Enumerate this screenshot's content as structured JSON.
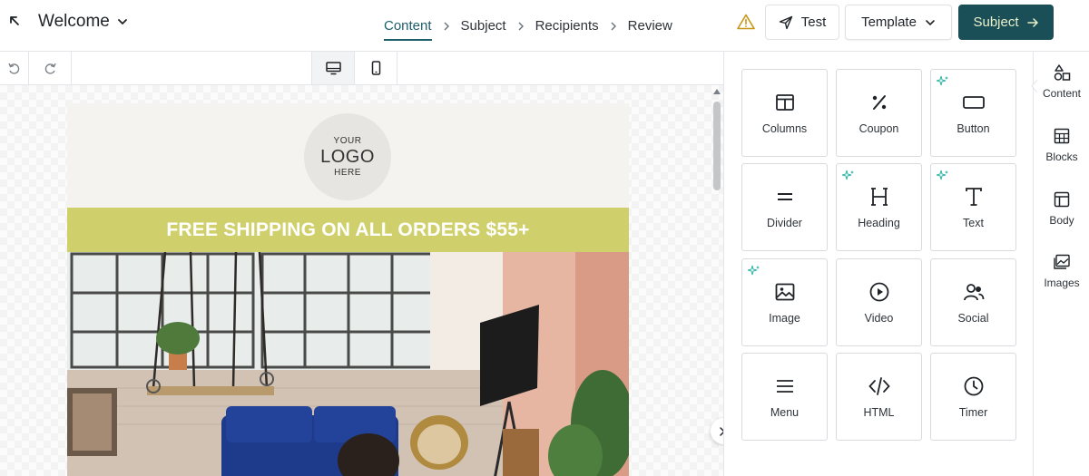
{
  "header": {
    "title": "Welcome",
    "steps": [
      "Content",
      "Subject",
      "Recipients",
      "Review"
    ],
    "active_step": "Content",
    "test_label": "Test",
    "template_label": "Template",
    "next_label": "Subject"
  },
  "email": {
    "logo_top": "YOUR",
    "logo_main": "LOGO",
    "logo_bottom": "HERE",
    "banner_text": "FREE SHIPPING ON ALL ORDERS $55+"
  },
  "content_blocks": [
    {
      "label": "Columns",
      "icon": "columns-icon",
      "ai": false
    },
    {
      "label": "Coupon",
      "icon": "percent-icon",
      "ai": false
    },
    {
      "label": "Button",
      "icon": "button-icon",
      "ai": true
    },
    {
      "label": "Divider",
      "icon": "divider-icon",
      "ai": false
    },
    {
      "label": "Heading",
      "icon": "heading-icon",
      "ai": true
    },
    {
      "label": "Text",
      "icon": "text-icon",
      "ai": true
    },
    {
      "label": "Image",
      "icon": "image-icon",
      "ai": true
    },
    {
      "label": "Video",
      "icon": "play-icon",
      "ai": false
    },
    {
      "label": "Social",
      "icon": "social-icon",
      "ai": false
    },
    {
      "label": "Menu",
      "icon": "menu-icon",
      "ai": false
    },
    {
      "label": "HTML",
      "icon": "code-icon",
      "ai": false
    },
    {
      "label": "Timer",
      "icon": "clock-icon",
      "ai": false
    }
  ],
  "side_nav": [
    {
      "label": "Content",
      "icon": "shapes-icon"
    },
    {
      "label": "Blocks",
      "icon": "blocks-icon"
    },
    {
      "label": "Body",
      "icon": "layout-icon"
    },
    {
      "label": "Images",
      "icon": "gallery-icon"
    }
  ],
  "colors": {
    "primary": "#1b4f57",
    "primary_text": "#e9f0c9",
    "active_step": "#1d5e6b",
    "banner": "#cfd06b",
    "warning": "#c89515",
    "ai_sparkle": "#2bb3a3"
  }
}
